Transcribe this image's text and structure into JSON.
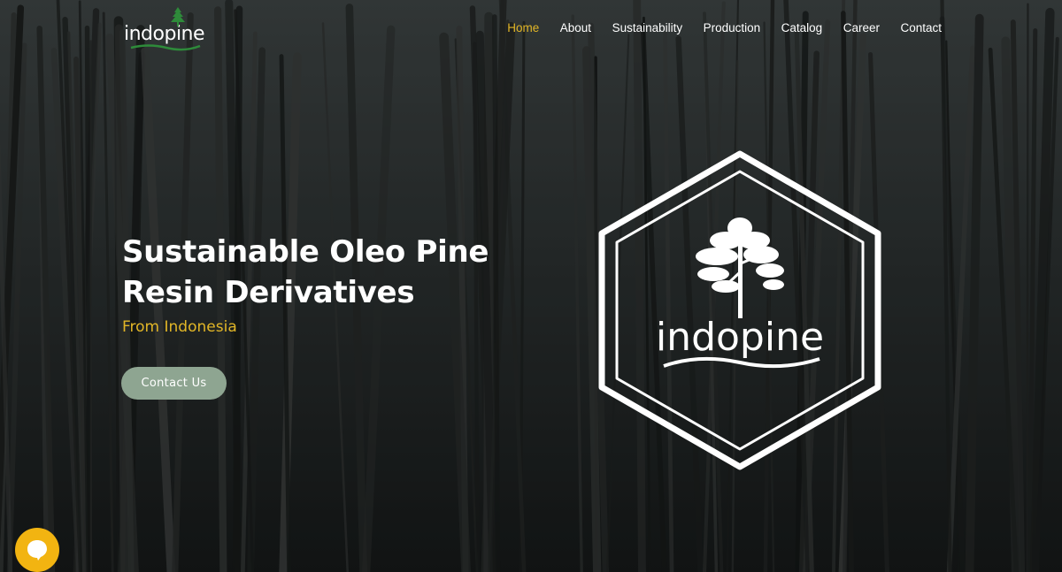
{
  "brand": {
    "logo_text": "indopine",
    "accent_color": "#e2b627",
    "logo_green": "#2e8b3a"
  },
  "nav": {
    "items": [
      {
        "label": "Home",
        "active": true
      },
      {
        "label": "About",
        "active": false
      },
      {
        "label": "Sustainability",
        "active": false
      },
      {
        "label": "Production",
        "active": false
      },
      {
        "label": "Catalog",
        "active": false
      },
      {
        "label": "Career",
        "active": false
      },
      {
        "label": "Contact",
        "active": false
      }
    ]
  },
  "hero": {
    "title_line1": "Sustainable Oleo Pine",
    "title_line2": "Resin Derivatives",
    "subtitle": "From Indonesia",
    "cta_label": "Contact Us",
    "cta_color": "#8ea591",
    "background": "pine-forest-photo"
  },
  "badge": {
    "text": "indopine",
    "icon": "pine-tree-icon"
  },
  "chat_widget": {
    "icon": "chat-bubble-icon",
    "color": "#f2b411"
  }
}
